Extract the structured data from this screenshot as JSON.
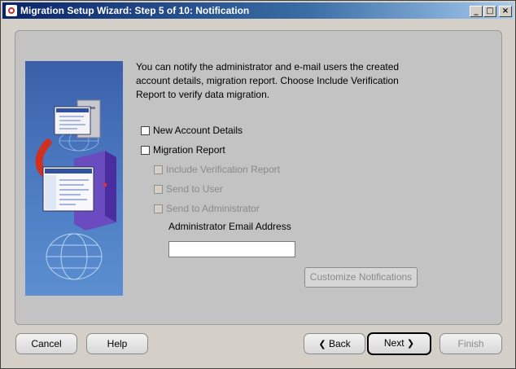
{
  "window": {
    "title": "Migration Setup Wizard: Step 5 of 10: Notification",
    "controls": {
      "minimize": "_",
      "maximize": "□",
      "close": "×"
    }
  },
  "main": {
    "intro_text": "You can notify the administrator and e-mail users the created account details, migration report. Choose Include Verification Report to verify data migration.",
    "options": [
      {
        "label": "New Account Details",
        "checked": false,
        "enabled": true
      },
      {
        "label": "Migration Report",
        "checked": false,
        "enabled": true
      },
      {
        "label": "Include Verification Report",
        "checked": false,
        "enabled": false
      },
      {
        "label": "Send to User",
        "checked": false,
        "enabled": false
      },
      {
        "label": "Send to Administrator",
        "checked": false,
        "enabled": false
      }
    ],
    "email_label": "Administrator Email Address",
    "email_value": "",
    "customize_label": "Customize Notifications"
  },
  "footer": {
    "cancel_label": "Cancel",
    "help_label": "Help",
    "back_label": "Back",
    "next_label": "Next",
    "finish_label": "Finish"
  },
  "icons": {
    "back": "chevron-left-icon",
    "next": "chevron-right-icon"
  },
  "colors": {
    "titlebar_start": "#0a246a",
    "titlebar_end": "#a6caf0",
    "illustration_blue": "#4a78c0",
    "arrow_red": "#d03020"
  }
}
